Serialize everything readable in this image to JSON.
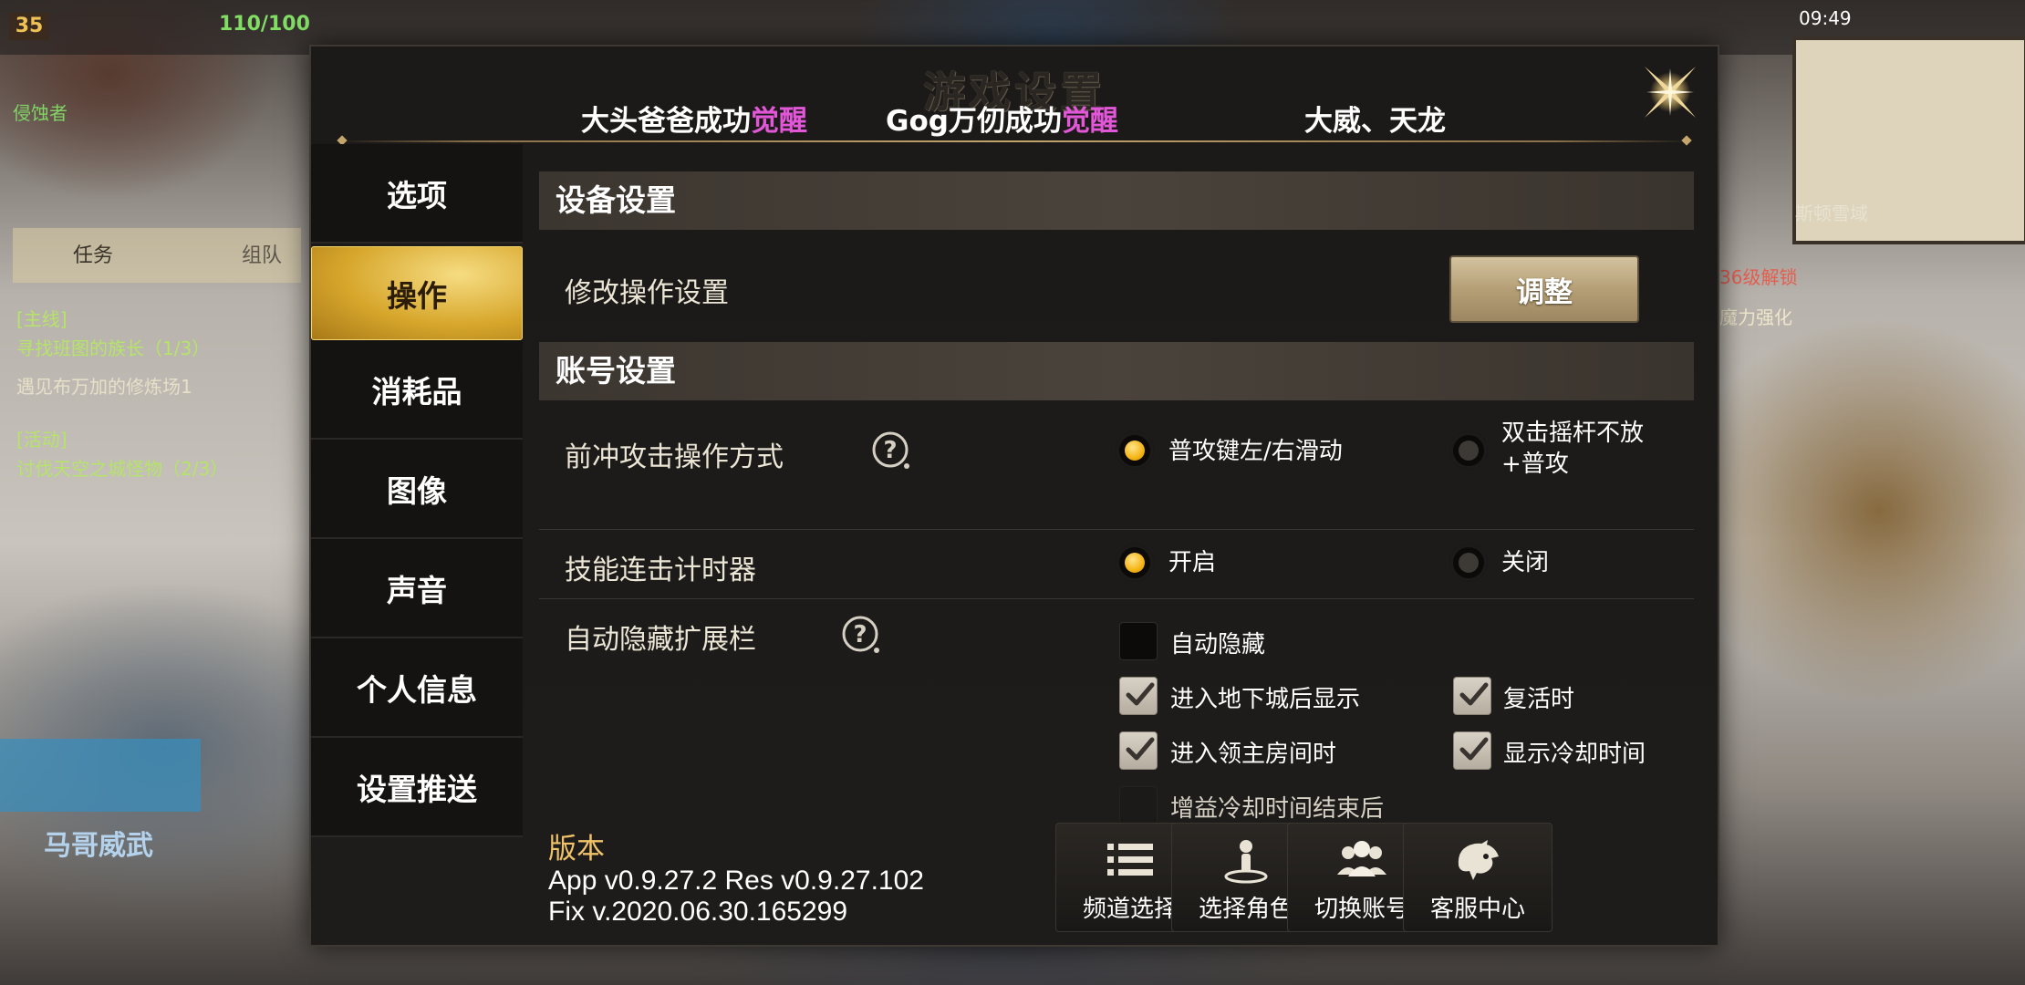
{
  "hud": {
    "level": "35",
    "hp": "110/100",
    "player_name": "侵蚀者",
    "quest_tab_1": "任务",
    "quest_tab_2": "组队",
    "quest_1_tag": "[主线]",
    "quest_1_title": "寻找班图的族长（1/3）",
    "quest_1_desc": "遇见布万加的修炼场1",
    "quest_2_tag": "[活动]",
    "quest_2_title": "讨伐天空之城怪物（2/3）",
    "left_name": "马哥威武",
    "time": "09:49",
    "minimap_label": "斯顿雪域",
    "side_badge": "36级解锁",
    "side_label": "魔力强化"
  },
  "dialog": {
    "title": "游戏设置",
    "marquee": [
      {
        "text": "大头爸爸成功",
        "highlight": "觉醒"
      },
      {
        "text": "Gog万仞成功",
        "highlight": "觉醒"
      },
      {
        "text": "大威、天龙",
        "highlight": ""
      }
    ]
  },
  "menu": [
    {
      "label": "选项",
      "active": false
    },
    {
      "label": "操作",
      "active": true
    },
    {
      "label": "消耗品",
      "active": false
    },
    {
      "label": "图像",
      "active": false
    },
    {
      "label": "声音",
      "active": false
    },
    {
      "label": "个人信息",
      "active": false
    },
    {
      "label": "设置推送",
      "active": false
    }
  ],
  "device_section": {
    "title": "设备设置",
    "row_label": "修改操作设置",
    "button": "调整"
  },
  "account_section": {
    "title": "账号设置",
    "dash_attack": {
      "label": "前冲攻击操作方式",
      "option_a": "普攻键左/右滑动",
      "option_b": "双击摇杆不放+普攻",
      "selected": "a"
    },
    "combo_timer": {
      "label": "技能连击计时器",
      "option_a": "开启",
      "option_b": "关闭",
      "selected": "a"
    },
    "auto_hide": {
      "label": "自动隐藏扩展栏",
      "options": [
        {
          "label": "自动隐藏",
          "checked": false
        },
        {
          "label": "进入地下城后显示",
          "checked": true
        },
        {
          "label": "复活时",
          "checked": true
        },
        {
          "label": "进入领主房间时",
          "checked": true
        },
        {
          "label": "显示冷却时间",
          "checked": true
        },
        {
          "label": "增益冷却时间结束后",
          "checked": false
        }
      ]
    }
  },
  "version": {
    "title": "版本",
    "line1": "App v0.9.27.2 Res v0.9.27.102",
    "line2": "Fix v.2020.06.30.165299"
  },
  "footer_buttons": [
    {
      "label": "频道选择",
      "icon": "list-icon"
    },
    {
      "label": "选择角色",
      "icon": "character-icon"
    },
    {
      "label": "切换账号",
      "icon": "users-icon"
    },
    {
      "label": "客服中心",
      "icon": "support-icon"
    }
  ]
}
